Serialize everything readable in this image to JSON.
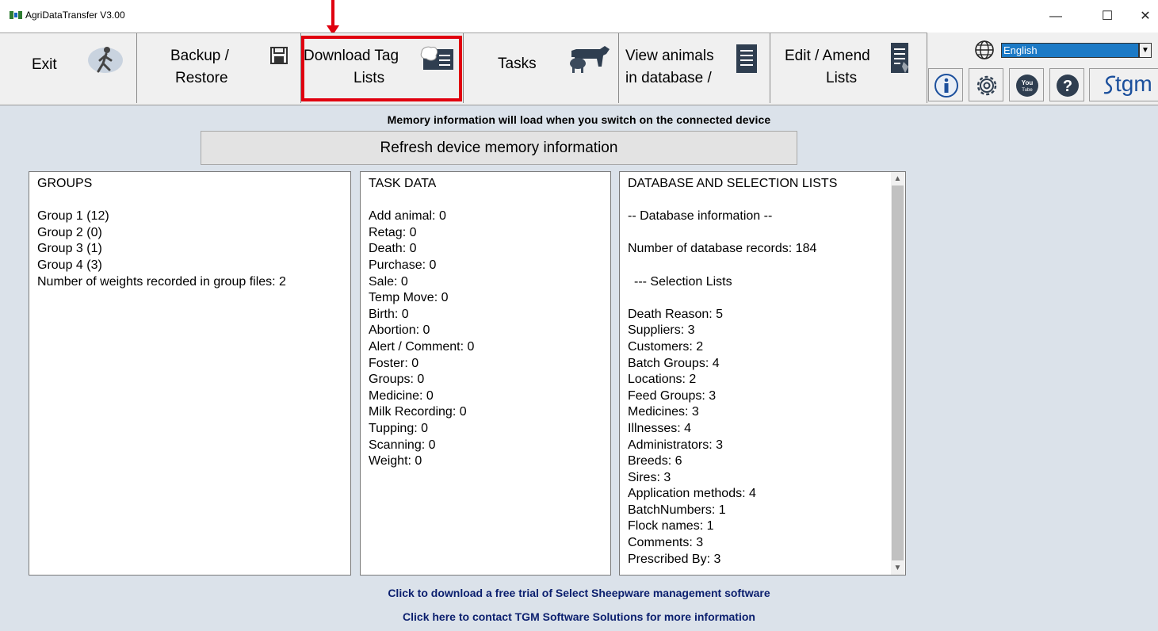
{
  "window": {
    "title": "AgriDataTransfer V3.00",
    "controls": {
      "minimize": "—",
      "maximize": "☐",
      "close": "✕"
    }
  },
  "toolbar": {
    "exit": {
      "label": "Exit",
      "icon": "walking-person-icon"
    },
    "backup": {
      "line1": "Backup /",
      "line2": "Restore",
      "icon": "floppy-disk-icon"
    },
    "download": {
      "line1": "Download Tag",
      "line2": "Lists",
      "icon": "sheep-list-icon"
    },
    "tasks": {
      "label": "Tasks",
      "icon": "livestock-icon"
    },
    "view": {
      "line1": "View animals",
      "line2": "in database /",
      "icon": "document-list-icon"
    },
    "edit": {
      "line1": "Edit / Amend",
      "line2": "Lists",
      "icon": "edit-list-icon"
    }
  },
  "language": {
    "selected": "English"
  },
  "right_icons": [
    "info-icon",
    "settings-gear-icon",
    "youtube-icon",
    "help-icon",
    "tgm-logo"
  ],
  "brand_text": "tgm",
  "youtube_text": {
    "top": "You",
    "bottom": "Tube"
  },
  "memory_info": "Memory information will load when you switch on the connected device",
  "refresh_button": "Refresh device memory information",
  "groups": {
    "header": "GROUPS",
    "lines": [
      "Group 1 (12)",
      "Group 2 (0)",
      "Group 3 (1)",
      "Group 4 (3)",
      "Number of weights recorded in group files: 2"
    ]
  },
  "task_data": {
    "header": "TASK DATA",
    "lines": [
      "Add animal: 0",
      "Retag: 0",
      "Death: 0",
      "Purchase: 0",
      "Sale: 0",
      "Temp Move: 0",
      "Birth: 0",
      "Abortion: 0",
      "Alert / Comment: 0",
      "Foster: 0",
      "Groups: 0",
      "Medicine: 0",
      "Milk Recording: 0",
      "Tupping: 0",
      "Scanning: 0",
      "Weight: 0"
    ]
  },
  "database": {
    "header": "DATABASE AND SELECTION LISTS",
    "info_heading": "-- Database information --",
    "records": "Number of database records: 184",
    "lists_heading": "--- Selection Lists",
    "lists": [
      "Death Reason: 5",
      "Suppliers: 3",
      "Customers: 2",
      "Batch Groups: 4",
      "Locations: 2",
      "Feed Groups: 3",
      "Medicines: 3",
      "Illnesses: 4",
      "Administrators: 3",
      "Breeds: 6",
      "Sires: 3",
      "Application methods: 4",
      "BatchNumbers: 1",
      "Flock names: 1",
      "Comments: 3",
      "Prescribed By: 3"
    ]
  },
  "links": {
    "trial": "Click to download a free trial of Select Sheepware management software",
    "contact": "Click here to contact TGM Software Solutions for more information"
  }
}
